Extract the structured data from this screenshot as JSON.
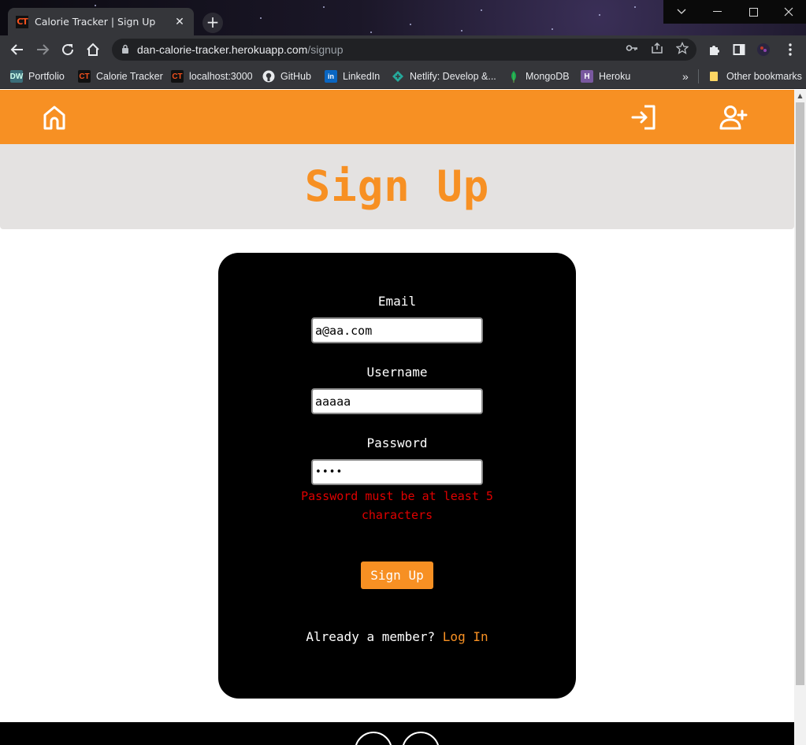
{
  "browser": {
    "tab_title": "Calorie Tracker | Sign Up",
    "tab_favicon": "CT",
    "url_host": "dan-calorie-tracker.herokuapp.com",
    "url_path": "/signup",
    "bookmarks": [
      {
        "label": "Portfolio",
        "icon": "DW"
      },
      {
        "label": "Calorie Tracker",
        "icon": "CT"
      },
      {
        "label": "localhost:3000",
        "icon": "CT"
      },
      {
        "label": "GitHub",
        "icon": "github-icon"
      },
      {
        "label": "LinkedIn",
        "icon": "in"
      },
      {
        "label": "Netlify: Develop &...",
        "icon": "netlify-icon"
      },
      {
        "label": "MongoDB",
        "icon": "mongodb-icon"
      },
      {
        "label": "Heroku",
        "icon": "heroku-icon"
      }
    ],
    "more_bookmarks": "»",
    "other_bookmarks": "Other bookmarks"
  },
  "page": {
    "title": "Sign Up",
    "form": {
      "email_label": "Email",
      "email_value": "a@aa.com",
      "username_label": "Username",
      "username_value": "aaaaa",
      "password_label": "Password",
      "password_value": "••••",
      "error_message": "Password must be at least 5 characters",
      "submit_label": "Sign Up",
      "already_text": "Already a member?",
      "login_link": "Log In"
    }
  },
  "colors": {
    "accent": "#f79023",
    "hero_bg": "#e4e2e1",
    "card_bg": "#000000",
    "error": "#e00000"
  }
}
